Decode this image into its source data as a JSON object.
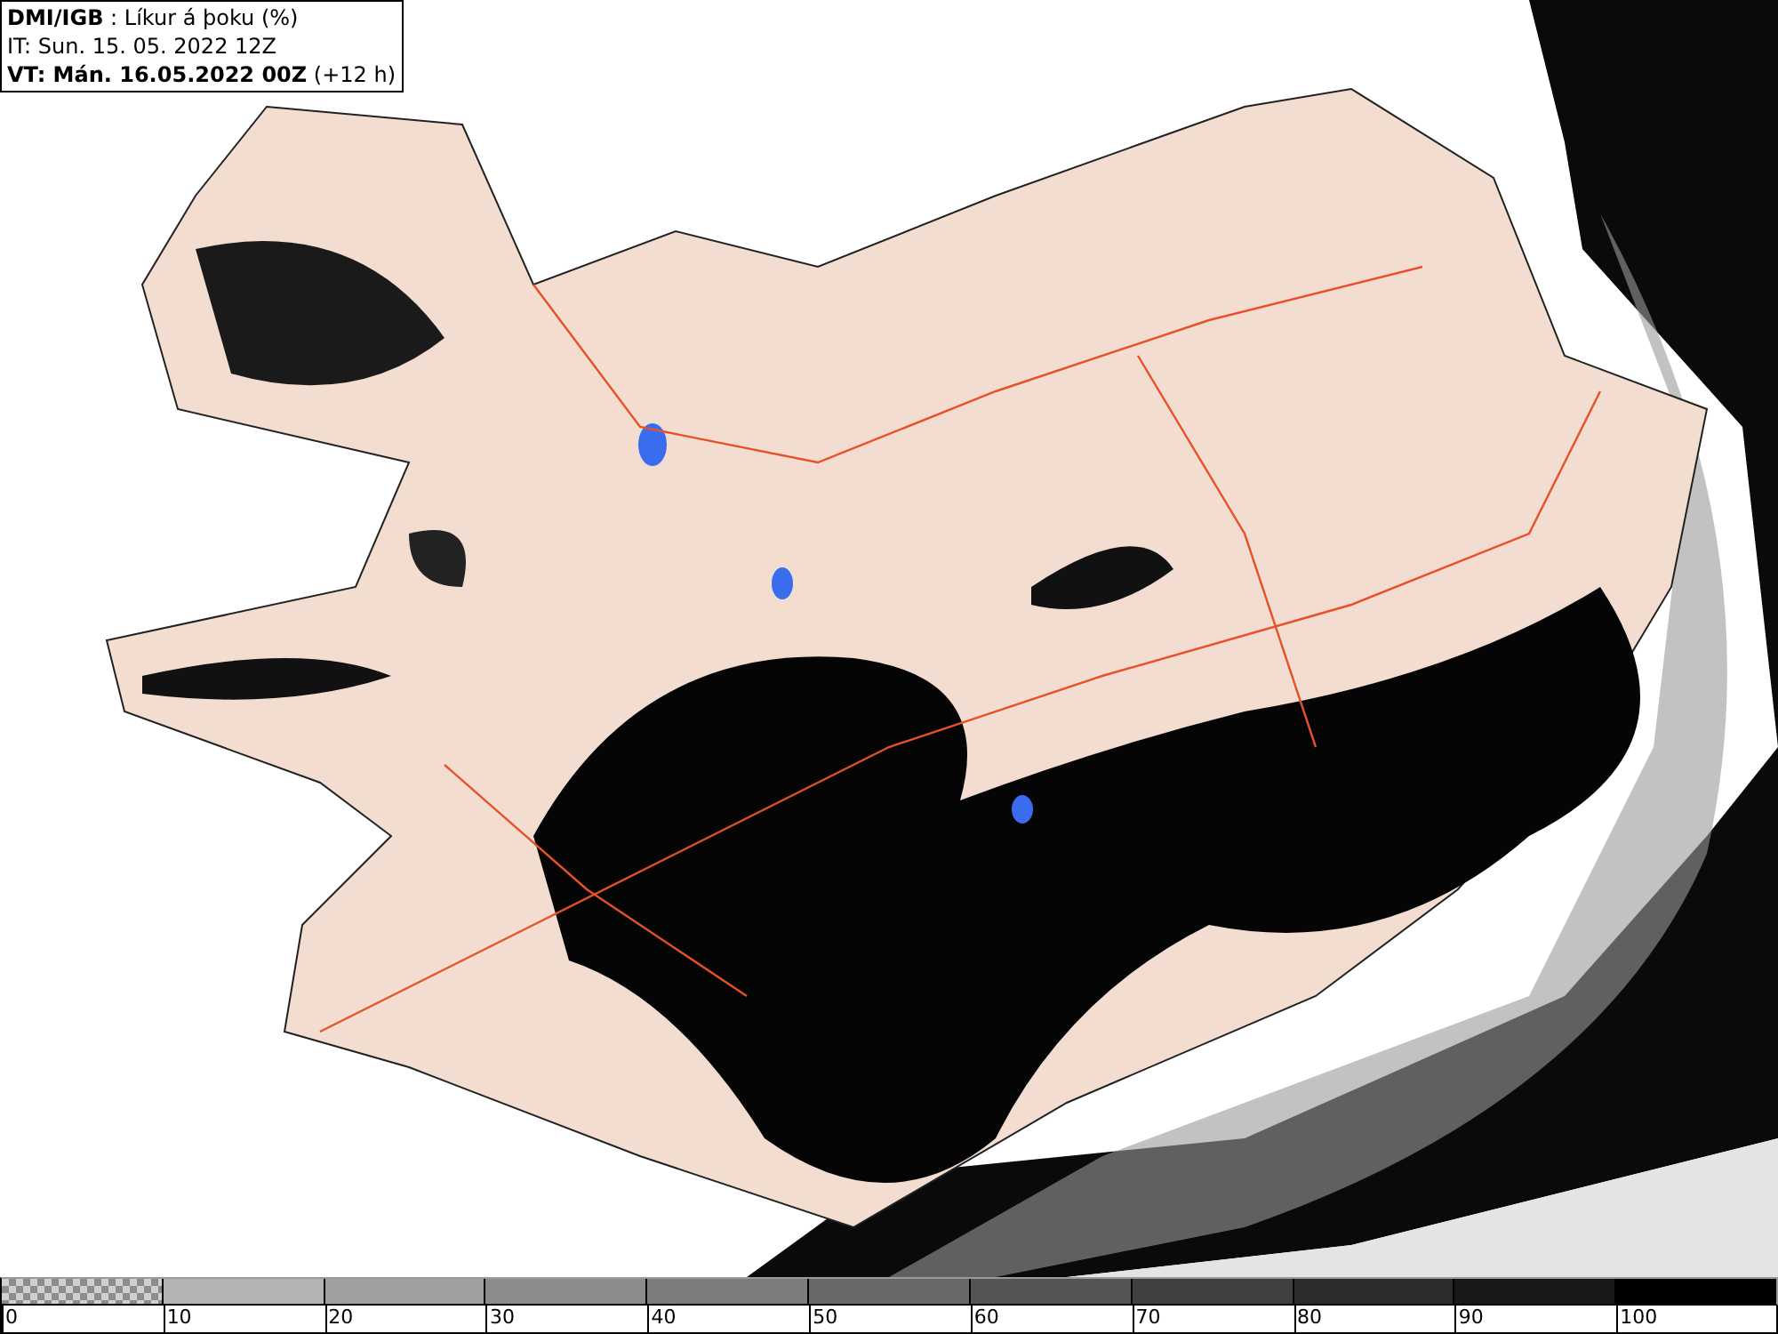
{
  "header": {
    "lines": [
      "**DMI/IGB** : Líkur á þoku (%)",
      "IT: Sun. 15. 05. 2022 12Z",
      "**VT: Mán. 16.05.2022 00Z** (+12 h)"
    ]
  },
  "legend": {
    "segments": [
      {
        "label": "0",
        "kind": "checker",
        "color": "#8c8c8c"
      },
      {
        "label": "10",
        "kind": "solid",
        "color": "#b4b4b4"
      },
      {
        "label": "20",
        "kind": "solid",
        "color": "#a0a0a0"
      },
      {
        "label": "30",
        "kind": "solid",
        "color": "#8c8c8c"
      },
      {
        "label": "40",
        "kind": "solid",
        "color": "#7c7c7c"
      },
      {
        "label": "50",
        "kind": "solid",
        "color": "#686868"
      },
      {
        "label": "60",
        "kind": "solid",
        "color": "#545454"
      },
      {
        "label": "70",
        "kind": "solid",
        "color": "#404040"
      },
      {
        "label": "80",
        "kind": "solid",
        "color": "#2c2c2c"
      },
      {
        "label": "90",
        "kind": "solid",
        "color": "#181818"
      },
      {
        "label": "100",
        "kind": "solid",
        "color": "#000000"
      }
    ]
  }
}
